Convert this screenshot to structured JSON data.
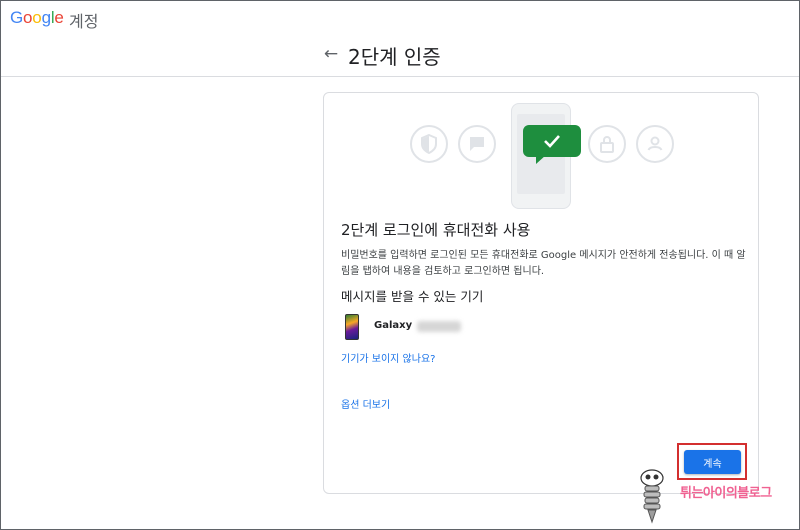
{
  "header": {
    "brand_letters": [
      "G",
      "o",
      "o",
      "g",
      "l",
      "e"
    ],
    "section": "계정"
  },
  "page": {
    "title": "2단계 인증"
  },
  "card": {
    "icons": [
      "shield-icon",
      "chat-icon",
      "phone-check-icon",
      "lock-icon",
      "account-icon"
    ],
    "heading": "2단계 로그인에 휴대전화 사용",
    "description": "비밀번호를 입력하면 로그인된 모든 휴대전화로 Google 메시지가 안전하게 전송됩니다. 이 때 알림을 탭하여 내용을 검토하고 로그인하면 됩니다.",
    "devices_heading": "메시지를 받을 수 있는 기기",
    "device_name": "Galaxy",
    "link_missing_device": "기기가 보이지 않나요?",
    "link_more_options": "옵션 더보기",
    "continue_label": "계속"
  },
  "watermark": "튀는아이의블로그",
  "colors": {
    "accent": "#1a73e8",
    "success": "#1e8e3e",
    "highlight_box": "#d32f2f"
  }
}
